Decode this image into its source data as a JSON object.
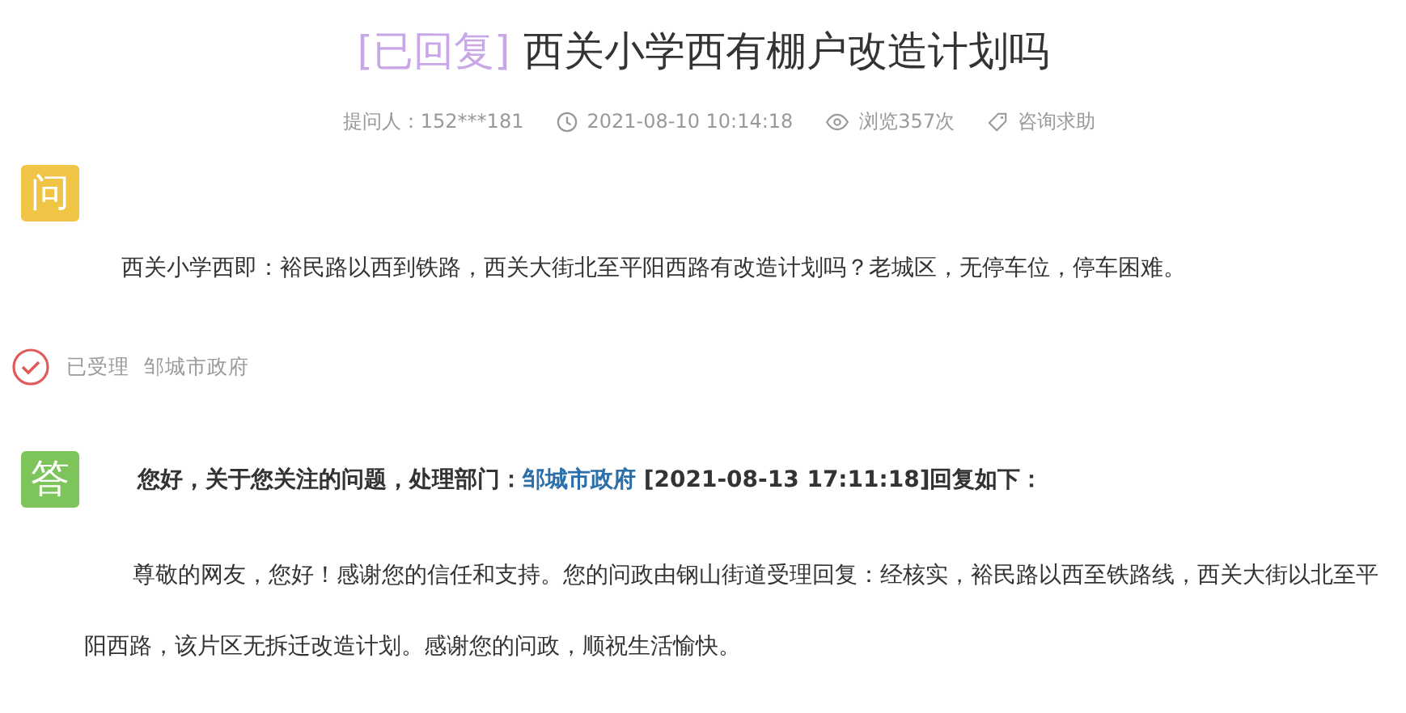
{
  "title": {
    "status_tag": "[已回复]",
    "text": "西关小学西有棚户改造计划吗"
  },
  "meta": [
    {
      "kind": "person",
      "text": "提问人：152***181"
    },
    {
      "kind": "time",
      "text": "2021-08-10 10:14:18"
    },
    {
      "kind": "views",
      "text": "浏览357次"
    },
    {
      "kind": "tag",
      "text": "咨询求助"
    }
  ],
  "question": {
    "badge": "问",
    "text": "西关小学西即：裕民路以西到铁路，西关大街北至平阳西路有改造计划吗？老城区，无停车位，停车困难。"
  },
  "status": {
    "state": "已受理",
    "department": "邹城市政府"
  },
  "answer": {
    "badge": "答",
    "header_prefix": "您好，关于您关注的问题，处理部门：",
    "department": "邹城市政府",
    "header_suffix": "[2021-08-13 17:11:18]回复如下：",
    "text": "尊敬的网友，您好！感谢您的信任和支持。您的问政由钢山街道受理回复：经核实，裕民路以西至铁路线，西关大街以北至平阳西路，该片区无拆迁改造计划。感谢您的问政，顺祝生活愉快。"
  }
}
